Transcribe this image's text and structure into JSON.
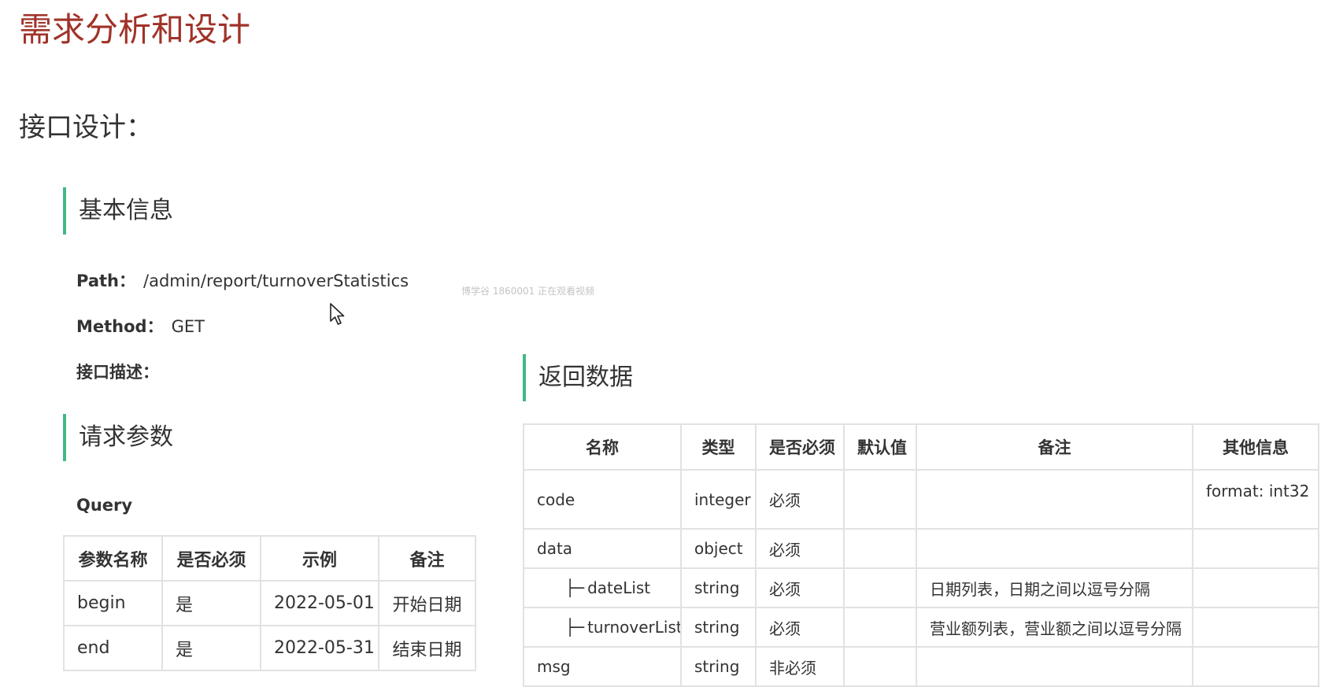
{
  "page_title": "需求分析和设计",
  "section_title": "接口设计：",
  "basic_info": {
    "heading": "基本信息",
    "path_label": "Path：",
    "path_value": "/admin/report/turnoverStatistics",
    "method_label": "Method：",
    "method_value": "GET",
    "desc_label": "接口描述："
  },
  "watermark": "博学谷 1860001 正在观看视频",
  "request": {
    "heading": "请求参数",
    "query_label": "Query",
    "columns": [
      "参数名称",
      "是否必须",
      "示例",
      "备注"
    ],
    "rows": [
      [
        "begin",
        "是",
        "2022-05-01",
        "开始日期"
      ],
      [
        "end",
        "是",
        "2022-05-31",
        "结束日期"
      ]
    ]
  },
  "response": {
    "heading": "返回数据",
    "columns": [
      "名称",
      "类型",
      "是否必须",
      "默认值",
      "备注",
      "其他信息"
    ],
    "rows": [
      [
        "code",
        "integer",
        "必须",
        "",
        "",
        "format: int32"
      ],
      [
        "data",
        "object",
        "必须",
        "",
        "",
        ""
      ],
      [
        "dateList",
        "string",
        "必须",
        "",
        "日期列表，日期之间以逗号分隔",
        ""
      ],
      [
        "turnoverList",
        "string",
        "必须",
        "",
        "营业额列表，营业额之间以逗号分隔",
        ""
      ],
      [
        "msg",
        "string",
        "非必须",
        "",
        "",
        ""
      ]
    ],
    "child_branch": "├─"
  },
  "icons": {
    "cursor": "mouse-pointer-icon"
  },
  "colors": {
    "title": "#a03228",
    "accent_bar": "#42b983",
    "border": "#e2e2e2"
  }
}
